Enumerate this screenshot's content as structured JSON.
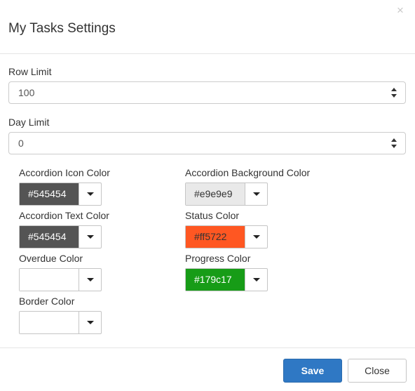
{
  "dialog": {
    "title": "My Tasks Settings",
    "close_glyph": "×"
  },
  "row_limit": {
    "label": "Row Limit",
    "value": "100"
  },
  "day_limit": {
    "label": "Day Limit",
    "value": "0"
  },
  "pickers": {
    "accordion_icon": {
      "label": "Accordion Icon Color",
      "value": "#545454",
      "color": "#545454",
      "text_color": "#ffffff"
    },
    "accordion_text": {
      "label": "Accordion Text Color",
      "value": "#545454",
      "color": "#545454",
      "text_color": "#ffffff"
    },
    "overdue": {
      "label": "Overdue Color",
      "value": "",
      "color": "#ffffff",
      "text_color": "#333333"
    },
    "border": {
      "label": "Border Color",
      "value": "",
      "color": "#ffffff",
      "text_color": "#333333"
    },
    "accordion_background": {
      "label": "Accordion Background Color",
      "value": "#e9e9e9",
      "color": "#e9e9e9",
      "text_color": "#333333"
    },
    "status": {
      "label": "Status Color",
      "value": "#ff5722",
      "color": "#ff5722",
      "text_color": "#333333"
    },
    "progress": {
      "label": "Progress Color",
      "value": "#179c17",
      "color": "#179c17",
      "text_color": "#ffffff"
    }
  },
  "footer": {
    "save_label": "Save",
    "close_label": "Close"
  },
  "colors": {
    "primary": "#2f78c4",
    "divider": "#e5e5e5"
  }
}
